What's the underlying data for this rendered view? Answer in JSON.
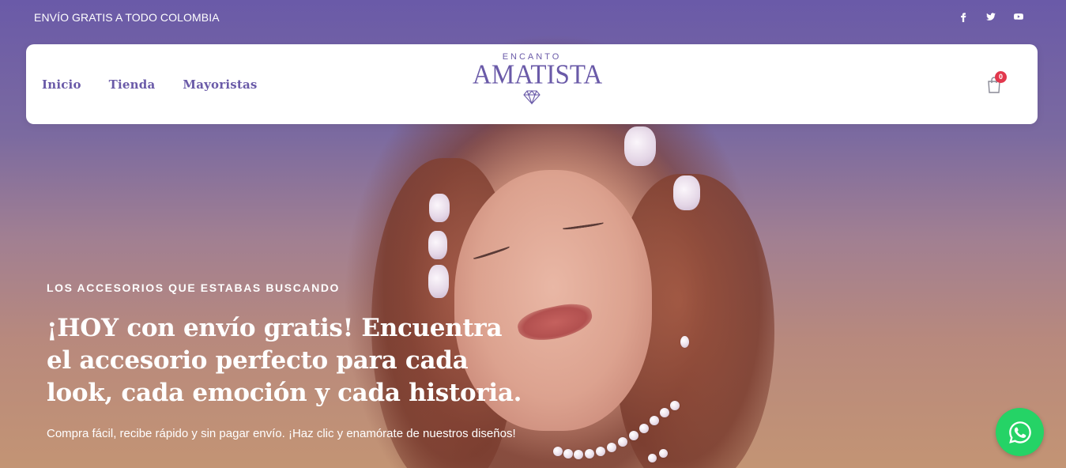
{
  "topbar": {
    "announcement": "ENVÍO GRATIS A TODO COLOMBIA",
    "social_icons": [
      "facebook-icon",
      "twitter-icon",
      "youtube-icon"
    ]
  },
  "header": {
    "nav": [
      "Inicio",
      "Tienda",
      "Mayoristas"
    ],
    "logo": {
      "small": "ENCANTO",
      "big": "AMATISTA"
    },
    "cart": {
      "count": "0"
    }
  },
  "hero": {
    "eyebrow": "LOS ACCESORIOS QUE ESTABAS BUSCANDO",
    "headline": "¡HOY con envío gratis! Encuentra el accesorio perfecto para cada look, cada emoción y cada historia.",
    "subtext": "Compra fácil, recibe rápido y sin pagar envío. ¡Haz clic y enamórate de nuestros diseños!"
  },
  "colors": {
    "brand_purple": "#6a5aa8",
    "badge_red": "#e2384d",
    "whatsapp_green": "#25d366"
  }
}
